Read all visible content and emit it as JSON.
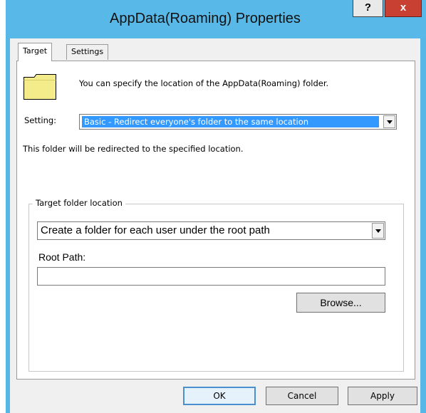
{
  "window": {
    "title": "AppData(Roaming) Properties",
    "help_label": "?",
    "close_label": "x"
  },
  "tabs": [
    {
      "label": "Target",
      "active": true
    },
    {
      "label": "Settings",
      "active": false
    }
  ],
  "target": {
    "icon": "folder-icon",
    "description": "You can specify the location of the AppData(Roaming) folder.",
    "setting_label": "Setting:",
    "setting_value": "Basic - Redirect everyone's folder to the same location",
    "redirect_text": "This folder will be redirected to the specified location.",
    "group_label": "Target folder location",
    "location_value": "Create a folder for each user under the root path",
    "root_path_label": "Root Path:",
    "root_path_value": "",
    "browse_label": "Browse..."
  },
  "footer": {
    "ok_label": "OK",
    "cancel_label": "Cancel",
    "apply_label": "Apply"
  },
  "colors": {
    "title_bar": "#58b8e7",
    "close_button": "#c84031",
    "selection": "#3399ff",
    "folder": "#f4ec8a"
  }
}
